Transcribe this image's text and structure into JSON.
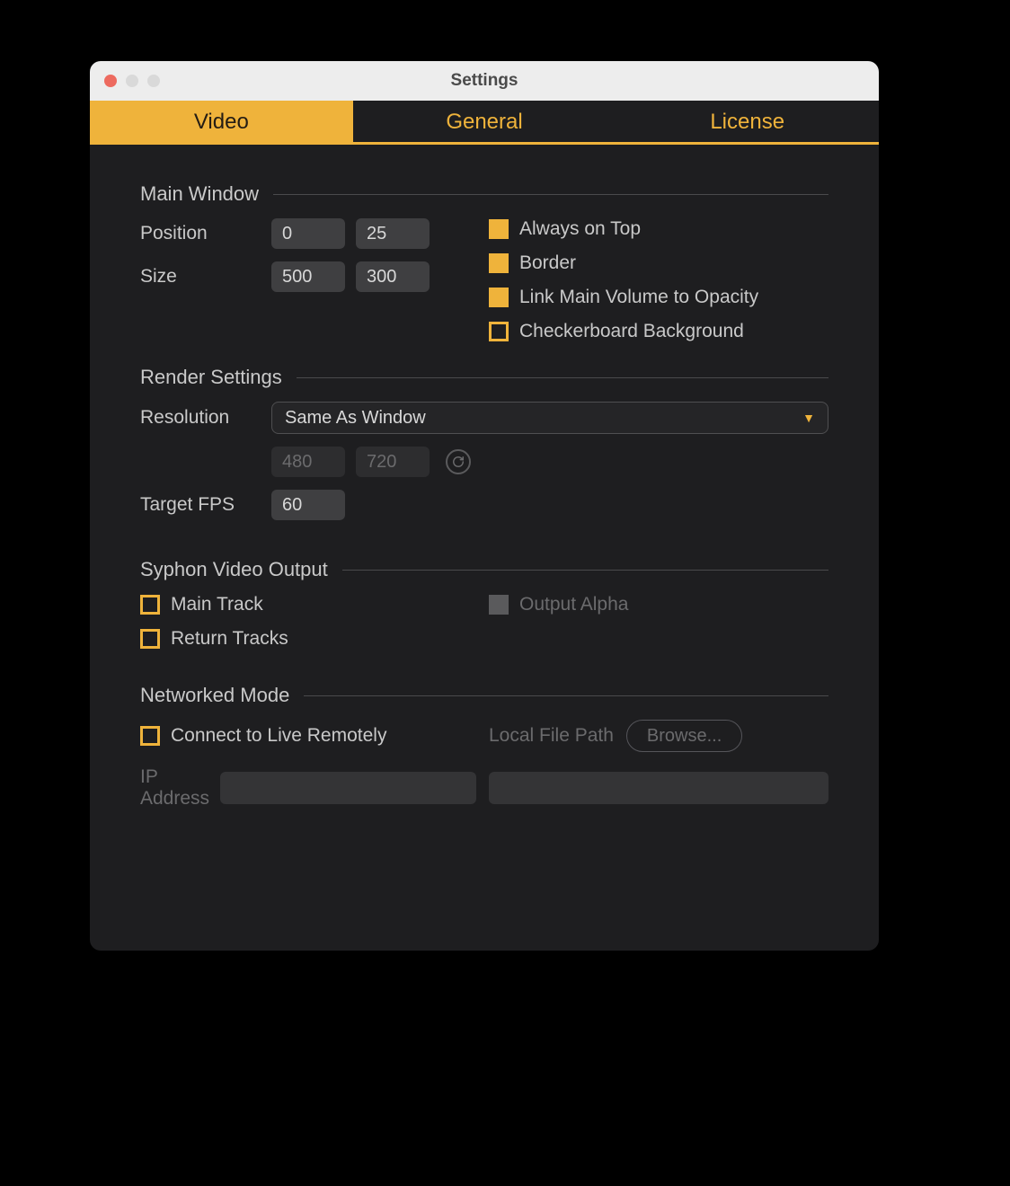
{
  "window": {
    "title": "Settings"
  },
  "tabs": {
    "video": "Video",
    "general": "General",
    "license": "License",
    "active": "video"
  },
  "sections": {
    "main_window": {
      "heading": "Main Window",
      "position_label": "Position",
      "position_x": "0",
      "position_y": "25",
      "size_label": "Size",
      "size_w": "500",
      "size_h": "300",
      "always_on_top": {
        "label": "Always on Top",
        "checked": true
      },
      "border": {
        "label": "Border",
        "checked": true
      },
      "link_volume": {
        "label": "Link Main Volume to Opacity",
        "checked": true
      },
      "checkerboard": {
        "label": "Checkerboard Background",
        "checked": false
      }
    },
    "render": {
      "heading": "Render Settings",
      "resolution_label": "Resolution",
      "resolution_value": "Same As Window",
      "res_w": "480",
      "res_h": "720",
      "fps_label": "Target FPS",
      "fps_value": "60"
    },
    "syphon": {
      "heading": "Syphon Video Output",
      "main_track": {
        "label": "Main Track",
        "checked": false
      },
      "return_tracks": {
        "label": "Return Tracks",
        "checked": false
      },
      "output_alpha": {
        "label": "Output Alpha",
        "checked": false,
        "disabled": true
      }
    },
    "network": {
      "heading": "Networked Mode",
      "connect_remote": {
        "label": "Connect to Live Remotely",
        "checked": false
      },
      "local_file_label": "Local File Path",
      "browse_label": "Browse...",
      "ip_label": "IP Address",
      "ip_value": "",
      "path_value": ""
    }
  }
}
